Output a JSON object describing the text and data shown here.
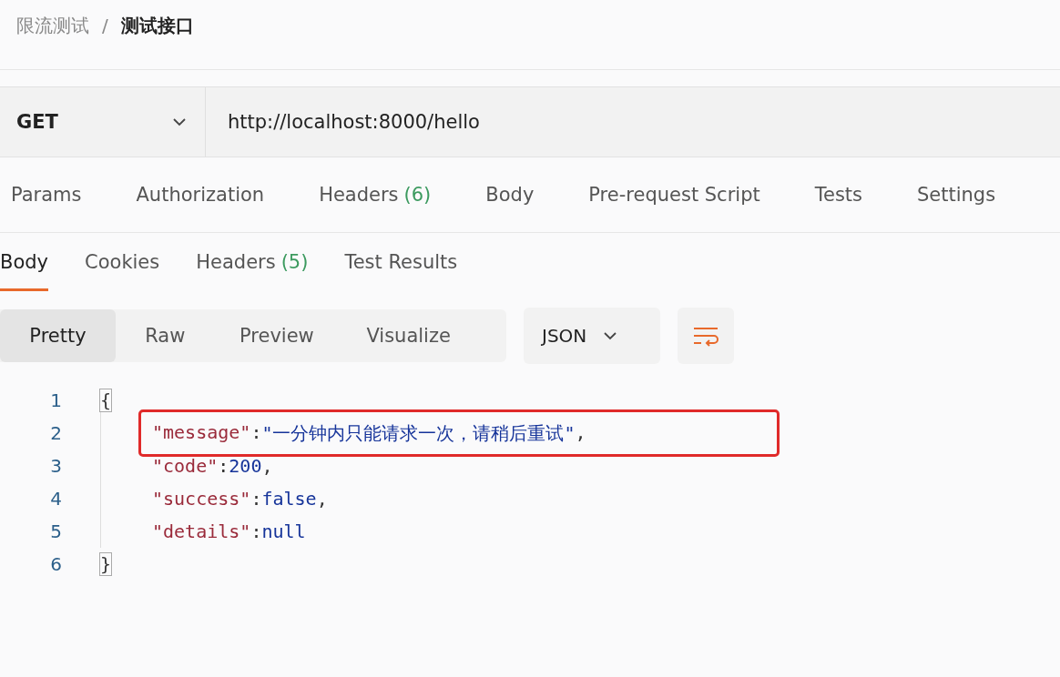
{
  "breadcrumb": {
    "items": [
      "限流测试",
      "测试接口"
    ],
    "separator": "/"
  },
  "request": {
    "method": "GET",
    "url": "http://localhost:8000/hello"
  },
  "request_tabs": [
    {
      "label": "Params",
      "selected": false
    },
    {
      "label": "Authorization",
      "selected": false
    },
    {
      "label": "Headers",
      "count": "(6)",
      "selected": false
    },
    {
      "label": "Body",
      "selected": false
    },
    {
      "label": "Pre-request Script",
      "selected": false
    },
    {
      "label": "Tests",
      "selected": false
    },
    {
      "label": "Settings",
      "selected": false
    }
  ],
  "response_tabs": [
    {
      "label": "Body",
      "selected": true
    },
    {
      "label": "Cookies",
      "selected": false
    },
    {
      "label": "Headers",
      "count": "(5)",
      "selected": false
    },
    {
      "label": "Test Results",
      "selected": false
    }
  ],
  "view_modes": [
    {
      "label": "Pretty",
      "selected": true
    },
    {
      "label": "Raw",
      "selected": false
    },
    {
      "label": "Preview",
      "selected": false
    },
    {
      "label": "Visualize",
      "selected": false
    }
  ],
  "format": "JSON",
  "code_lines": [
    {
      "number": "1",
      "indent": false,
      "highlighted": false,
      "tokens": [
        {
          "kind": "bracket",
          "text": "{"
        }
      ]
    },
    {
      "number": "2",
      "indent": true,
      "highlighted": true,
      "tokens": [
        {
          "kind": "key",
          "text": "\"message\""
        },
        {
          "kind": "punct",
          "text": ": "
        },
        {
          "kind": "string",
          "text": "\"一分钟内只能请求一次，请稍后重试\""
        },
        {
          "kind": "punct",
          "text": ","
        }
      ]
    },
    {
      "number": "3",
      "indent": true,
      "highlighted": false,
      "tokens": [
        {
          "kind": "key",
          "text": "\"code\""
        },
        {
          "kind": "punct",
          "text": ": "
        },
        {
          "kind": "number",
          "text": "200"
        },
        {
          "kind": "punct",
          "text": ","
        }
      ]
    },
    {
      "number": "4",
      "indent": true,
      "highlighted": false,
      "tokens": [
        {
          "kind": "key",
          "text": "\"success\""
        },
        {
          "kind": "punct",
          "text": ": "
        },
        {
          "kind": "keyword",
          "text": "false"
        },
        {
          "kind": "punct",
          "text": ","
        }
      ]
    },
    {
      "number": "5",
      "indent": true,
      "highlighted": false,
      "tokens": [
        {
          "kind": "key",
          "text": "\"details\""
        },
        {
          "kind": "punct",
          "text": ": "
        },
        {
          "kind": "keyword",
          "text": "null"
        }
      ]
    },
    {
      "number": "6",
      "indent": false,
      "highlighted": false,
      "tokens": [
        {
          "kind": "bracket",
          "text": "}"
        }
      ]
    }
  ]
}
